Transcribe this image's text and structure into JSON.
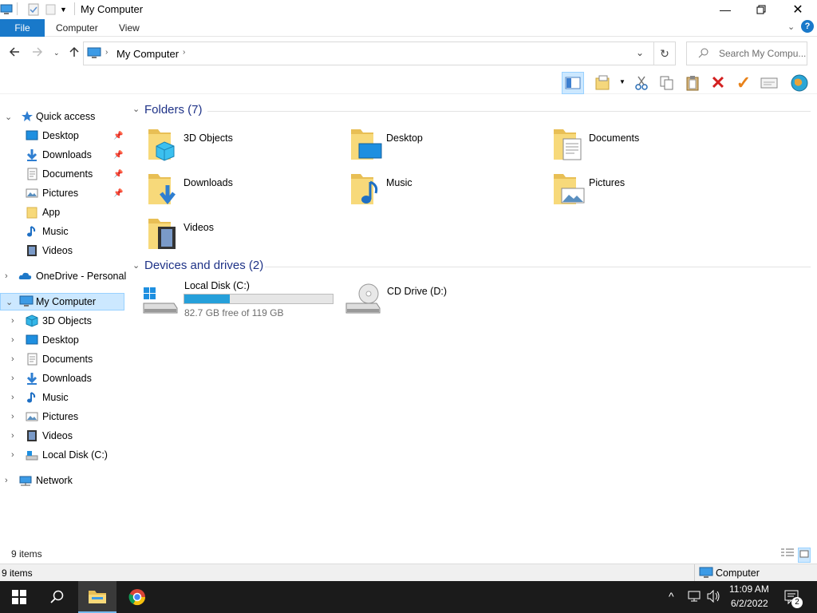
{
  "window": {
    "title": "My Computer",
    "minimize_icon": "minimize-icon",
    "maximize_icon": "restore-icon",
    "close_icon": "close-icon"
  },
  "ribbon": {
    "tabs": [
      {
        "label": "File"
      },
      {
        "label": "Computer"
      },
      {
        "label": "View"
      }
    ]
  },
  "address": {
    "path": "My Computer",
    "search_placeholder": "Search My Compu..."
  },
  "nav": {
    "quick_access": {
      "label": "Quick access"
    },
    "quick_items": [
      {
        "label": "Desktop",
        "pinned": true
      },
      {
        "label": "Downloads",
        "pinned": true
      },
      {
        "label": "Documents",
        "pinned": true
      },
      {
        "label": "Pictures",
        "pinned": true
      },
      {
        "label": "App",
        "pinned": false
      },
      {
        "label": "Music",
        "pinned": false
      },
      {
        "label": "Videos",
        "pinned": false
      }
    ],
    "onedrive": {
      "label": "OneDrive - Personal"
    },
    "my_computer": {
      "label": "My Computer"
    },
    "computer_items": [
      {
        "label": "3D Objects"
      },
      {
        "label": "Desktop"
      },
      {
        "label": "Documents"
      },
      {
        "label": "Downloads"
      },
      {
        "label": "Music"
      },
      {
        "label": "Pictures"
      },
      {
        "label": "Videos"
      },
      {
        "label": "Local Disk (C:)"
      }
    ],
    "network": {
      "label": "Network"
    }
  },
  "content": {
    "folders_header": "Folders (7)",
    "folders": [
      {
        "name": "3D Objects"
      },
      {
        "name": "Desktop"
      },
      {
        "name": "Documents"
      },
      {
        "name": "Downloads"
      },
      {
        "name": "Music"
      },
      {
        "name": "Pictures"
      },
      {
        "name": "Videos"
      }
    ],
    "devices_header": "Devices and drives (2)",
    "drives": [
      {
        "name": "Local Disk (C:)",
        "free_text": "82.7 GB free of 119 GB",
        "used_fraction": 0.305
      },
      {
        "name": "CD Drive (D:)"
      }
    ]
  },
  "status": {
    "items_count": "9 items",
    "items_count_bottom": "9 items",
    "location": "Computer"
  },
  "taskbar": {
    "time": "11:09 AM",
    "date": "6/2/2022",
    "notification_count": "2"
  },
  "colors": {
    "accent": "#1979ca",
    "selection_bg": "#cce8ff",
    "header_text": "#1e3287",
    "drive_bar": "#26a0da",
    "taskbar": "#1b1b1b"
  }
}
